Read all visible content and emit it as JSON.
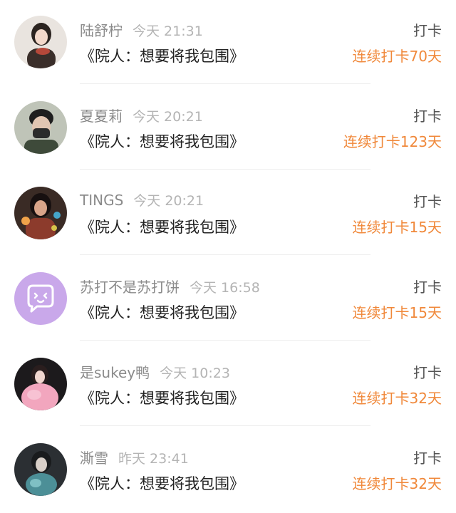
{
  "items": [
    {
      "name": "陆舒柠",
      "time": "今天 21:31",
      "title": "《院人：想要将我包围》",
      "action": "打卡",
      "streak": "连续打卡70天",
      "avatar": "avatar-photo-woman"
    },
    {
      "name": "夏夏莉",
      "time": "今天 20:21",
      "title": "《院人：想要将我包围》",
      "action": "打卡",
      "streak": "连续打卡123天",
      "avatar": "avatar-photo-man"
    },
    {
      "name": "TINGS",
      "time": "今天 20:21",
      "title": "《院人：想要将我包围》",
      "action": "打卡",
      "streak": "连续打卡15天",
      "avatar": "avatar-illustration"
    },
    {
      "name": "苏打不是苏打饼",
      "time": "今天 16:58",
      "title": "《院人：想要将我包围》",
      "action": "打卡",
      "streak": "连续打卡15天",
      "avatar": "avatar-default-chat-icon"
    },
    {
      "name": "是sukey鸭",
      "time": "今天 10:23",
      "title": "《院人：想要将我包围》",
      "action": "打卡",
      "streak": "连续打卡32天",
      "avatar": "avatar-photo-pink"
    },
    {
      "name": "澌雪",
      "time": "昨天 23:41",
      "title": "《院人：想要将我包围》",
      "action": "打卡",
      "streak": "连续打卡32天",
      "avatar": "avatar-photo-dark"
    }
  ],
  "colors": {
    "streak": "#f0883a",
    "name": "#8a8a8a",
    "time": "#b4b4b4",
    "title": "#222222",
    "action": "#555555",
    "default_avatar_bg": "#c9a8ea"
  }
}
